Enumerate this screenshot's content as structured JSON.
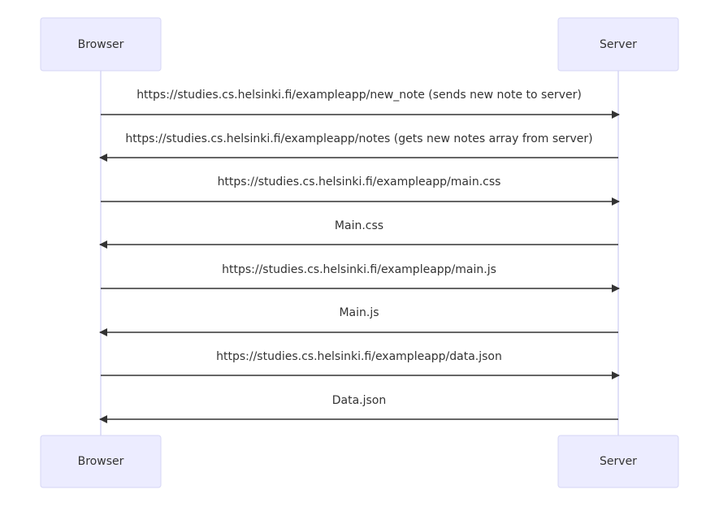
{
  "actors": [
    {
      "label": "Browser"
    },
    {
      "label": "Server"
    }
  ],
  "messages": [
    {
      "text": "https://studies.cs.helsinki.fi/exampleapp/new_note (sends new note to server)",
      "from": "Browser",
      "to": "Server"
    },
    {
      "text": "https://studies.cs.helsinki.fi/exampleapp/notes (gets new notes array from server)",
      "from": "Server",
      "to": "Browser"
    },
    {
      "text": "https://studies.cs.helsinki.fi/exampleapp/main.css",
      "from": "Browser",
      "to": "Server"
    },
    {
      "text": "Main.css",
      "from": "Server",
      "to": "Browser"
    },
    {
      "text": "https://studies.cs.helsinki.fi/exampleapp/main.js",
      "from": "Browser",
      "to": "Server"
    },
    {
      "text": "Main.js",
      "from": "Server",
      "to": "Browser"
    },
    {
      "text": "https://studies.cs.helsinki.fi/exampleapp/data.json",
      "from": "Browser",
      "to": "Server"
    },
    {
      "text": "Data.json",
      "from": "Server",
      "to": "Browser"
    }
  ],
  "colors": {
    "actor_fill": "#ececff",
    "actor_border": "#d6d6f5",
    "line": "#333333",
    "text": "#333333"
  }
}
